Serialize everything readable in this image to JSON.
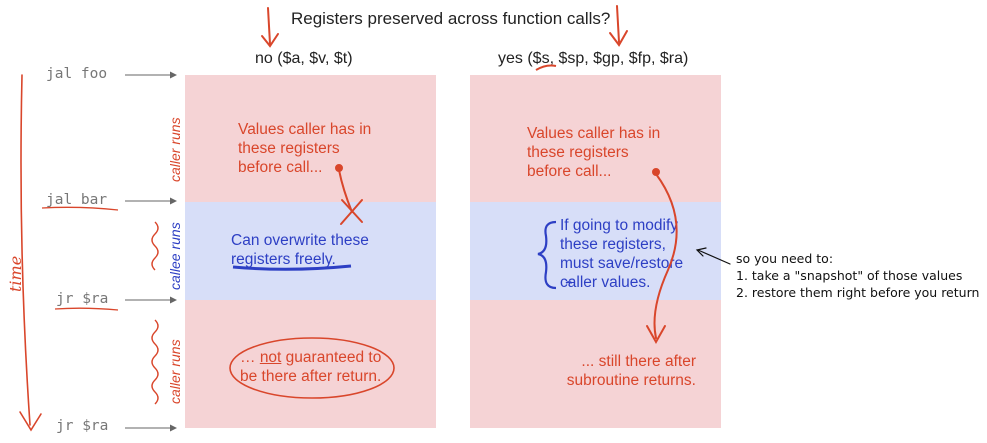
{
  "title": "Registers preserved across function calls?",
  "column_no_label": "no ($a, $v, $t)",
  "column_yes_label": "yes ($s, $sp, $gp, $fp, $ra)",
  "code_lines": [
    "jal foo",
    "jal bar",
    "jr $ra",
    "jr $ra"
  ],
  "phase_labels": [
    "caller runs",
    "callee runs",
    "caller runs"
  ],
  "time_label": "time",
  "left_panel": {
    "before_text": [
      "Values caller has in",
      "these registers",
      "before call..."
    ],
    "callee_text": [
      "Can overwrite these",
      "registers freely."
    ],
    "after_text": [
      "... not guaranteed to",
      "be there after return."
    ],
    "after_not_word": "not"
  },
  "right_panel": {
    "before_text": [
      "Values caller has in",
      "these registers",
      "before call..."
    ],
    "callee_text": [
      "If going to modify",
      "these registers,",
      "must save/restore",
      "caller values."
    ],
    "after_text": [
      "... still there after",
      "subroutine returns."
    ]
  },
  "side_note": [
    "so you need to:",
    "1. take a \"snapshot\" of those values",
    "2. restore them right before you return"
  ],
  "colors": {
    "caller_band": "#f5d3d5",
    "callee_band": "#d7def8",
    "annotation_red": "#d9462b",
    "annotation_blue": "#2d3fc4"
  }
}
